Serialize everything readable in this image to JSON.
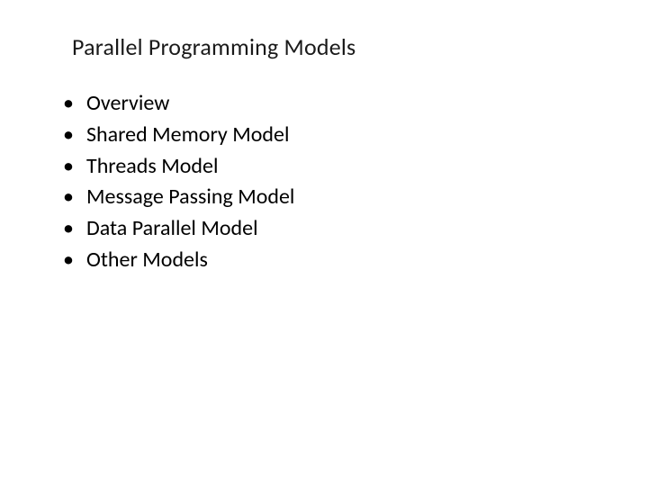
{
  "slide": {
    "title": "Parallel Programming Models",
    "bullets": [
      "Overview",
      "Shared Memory Model",
      "Threads Model",
      "Message Passing Model",
      "Data Parallel Model",
      "Other Models"
    ]
  }
}
